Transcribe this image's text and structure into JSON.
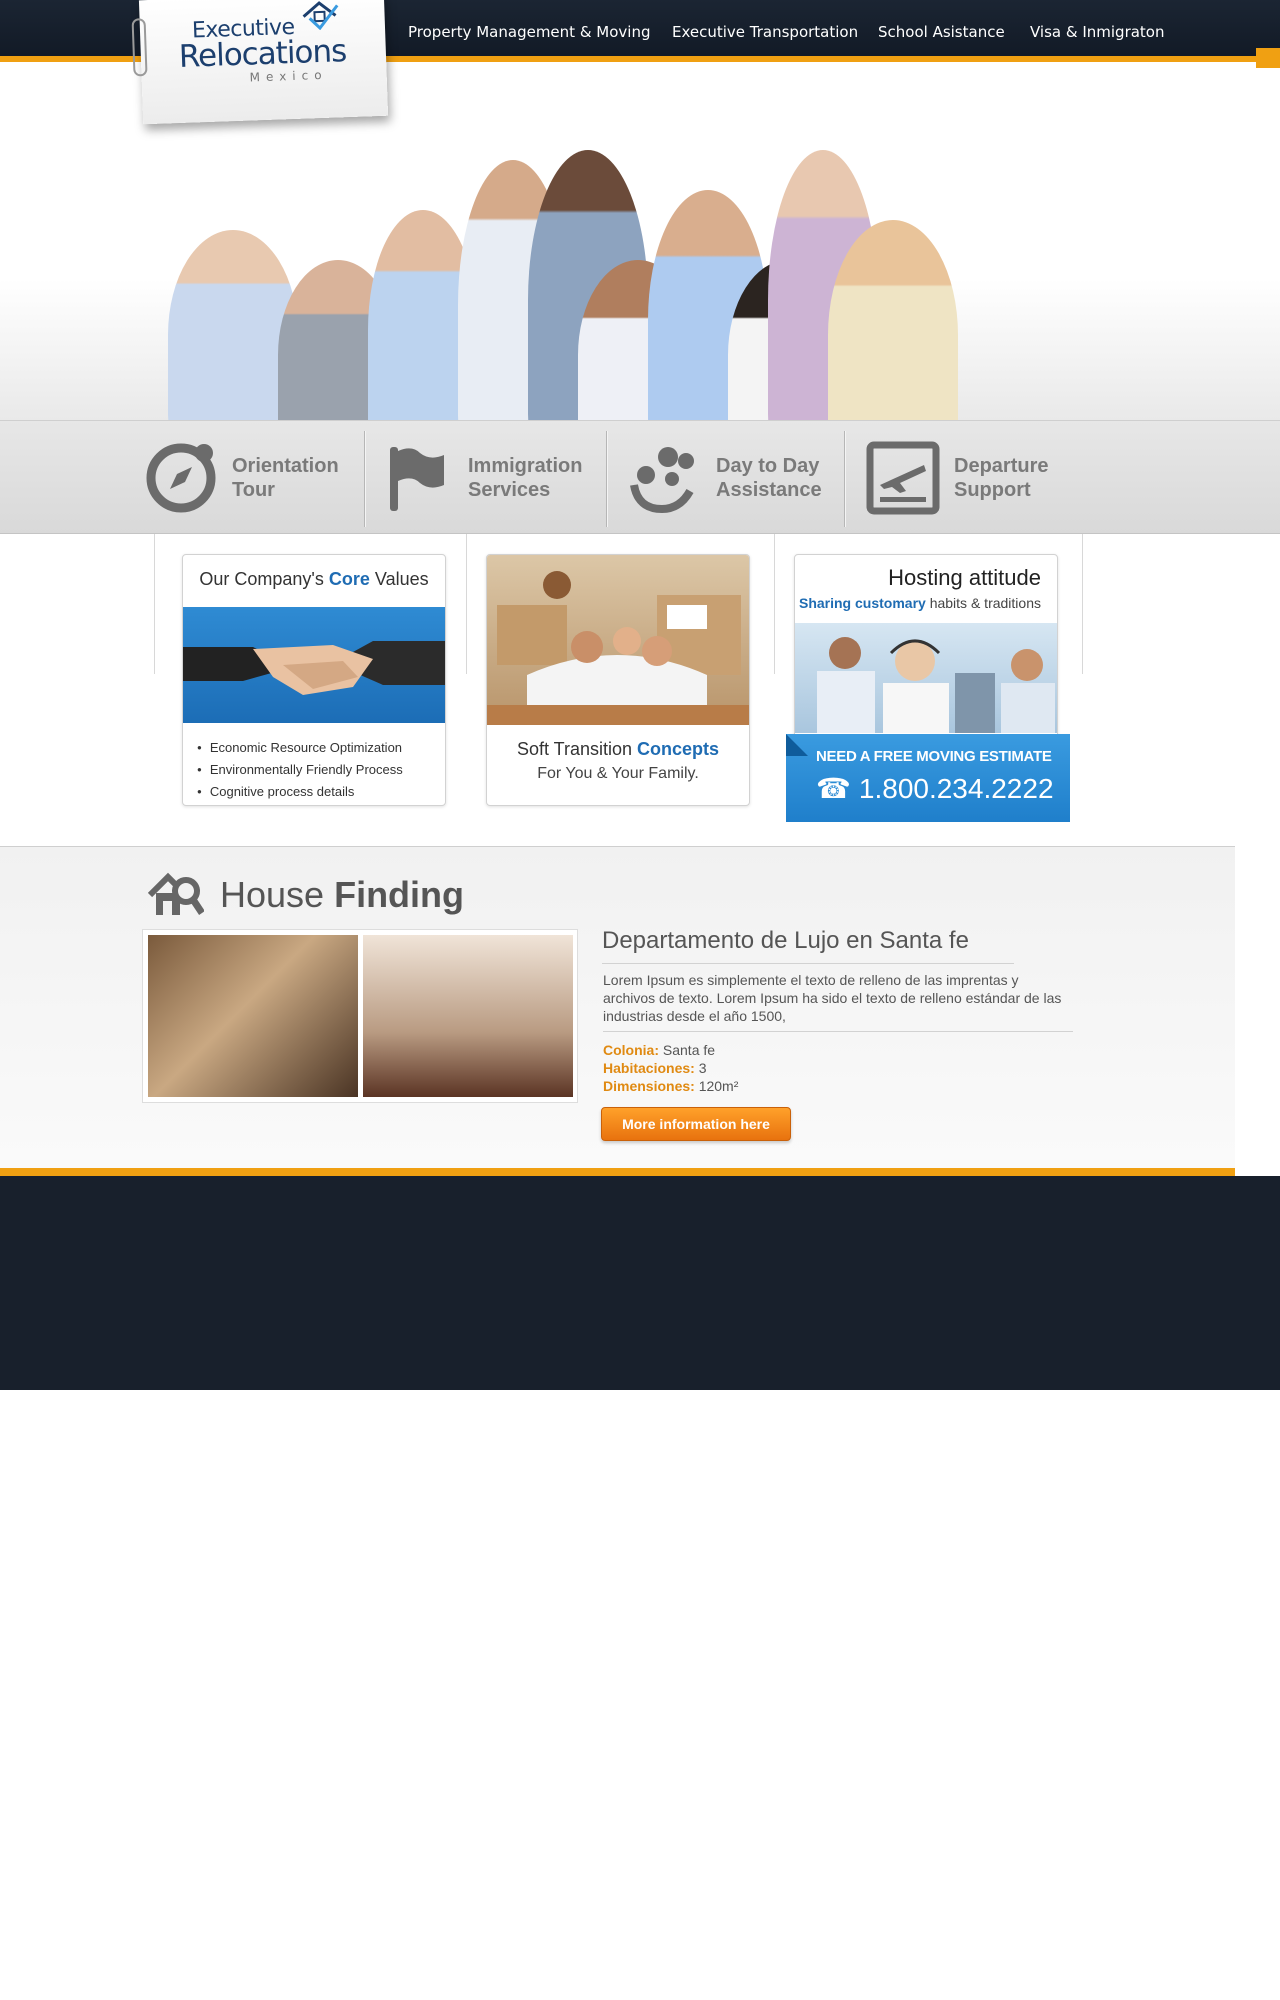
{
  "brand": {
    "line1": "Executive",
    "line2": "Relocations",
    "line3": "Mexico"
  },
  "nav": {
    "items": [
      {
        "label": "Property Management & Moving"
      },
      {
        "label": "Executive Transportation"
      },
      {
        "label": "School Asistance"
      },
      {
        "label": "Visa & Inmigraton"
      }
    ]
  },
  "services": [
    {
      "line1": "Orientation",
      "line2": "Tour",
      "icon": "compass-icon"
    },
    {
      "line1": "Immigration",
      "line2": "Services",
      "icon": "flag-icon"
    },
    {
      "line1": "Day to Day",
      "line2": "Assistance",
      "icon": "people-group-icon"
    },
    {
      "line1": "Departure",
      "line2": "Support",
      "icon": "plane-departure-icon"
    }
  ],
  "cards": {
    "values": {
      "title_pre": "Our Company's",
      "title_hl": "Core",
      "title_post": "Values",
      "items": [
        "Economic Resource Optimization",
        "Environmentally Friendly Process",
        "Cognitive process details"
      ]
    },
    "transition": {
      "line1_pre": "Soft Transition",
      "line1_hl": "Concepts",
      "line2": "For You & Your Family."
    },
    "hosting": {
      "title": "Hosting attitude",
      "sub_hl": "Sharing customary",
      "sub_rest": "habits & traditions"
    }
  },
  "estimate": {
    "title": "NEED A FREE MOVING ESTIMATE",
    "phone": "1.800.234.2222"
  },
  "house": {
    "title_light": "House",
    "title_bold": "Finding",
    "listing_title": "Departamento de Lujo en Santa fe",
    "description": "Lorem Ipsum es simplemente el texto de relleno de las imprentas y archivos de texto. Lorem Ipsum ha sido el texto de relleno estándar de las industrias desde el año 1500,",
    "fields": [
      {
        "label": "Colonia:",
        "value": "Santa fe"
      },
      {
        "label": "Habitaciones:",
        "value": "3"
      },
      {
        "label": "Dimensiones:",
        "value": "120m²"
      }
    ],
    "button": "More information here"
  },
  "colors": {
    "navy": "#18202c",
    "accent_orange": "#f0a012",
    "brand_blue": "#1f6cb3"
  }
}
